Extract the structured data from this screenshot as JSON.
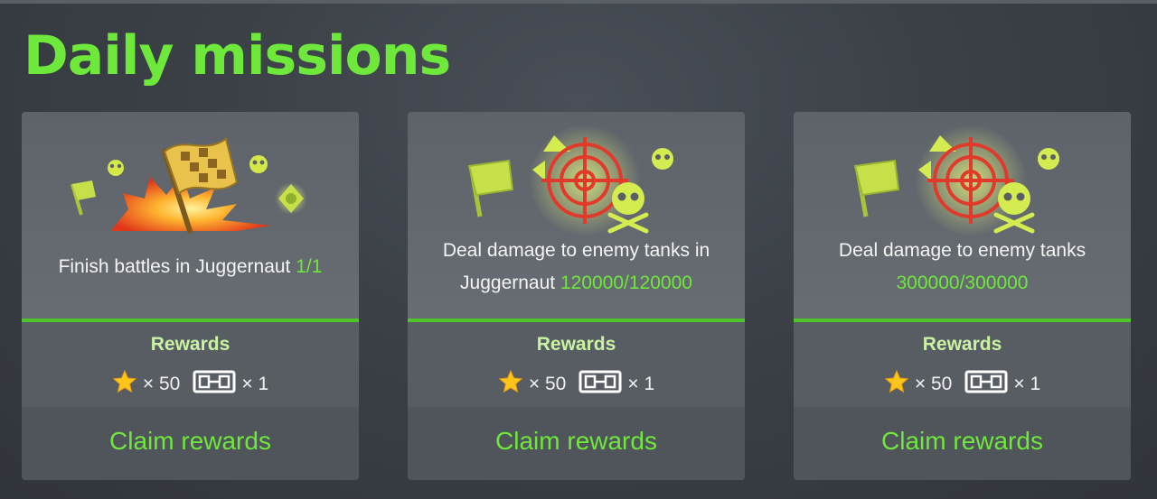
{
  "page": {
    "title": "Daily missions"
  },
  "colors": {
    "accent_green": "#6ee83a",
    "rewards_title": "#c9f3a3",
    "card_bg": "#686d74",
    "divider": "#4ec62a"
  },
  "missions": [
    {
      "illustration": "checkered-flag-explosion-icon",
      "description": "Finish battles in Juggernaut",
      "progress": "1/1",
      "rewards_title": "Rewards",
      "rewards": [
        {
          "icon": "star-icon",
          "count": "× 50"
        },
        {
          "icon": "ticket-icon",
          "count": "× 1"
        }
      ],
      "claim_label": "Claim rewards"
    },
    {
      "illustration": "crosshair-target-icon",
      "description": "Deal damage to enemy tanks in Juggernaut",
      "progress": "120000/120000",
      "rewards_title": "Rewards",
      "rewards": [
        {
          "icon": "star-icon",
          "count": "× 50"
        },
        {
          "icon": "ticket-icon",
          "count": "× 1"
        }
      ],
      "claim_label": "Claim rewards"
    },
    {
      "illustration": "crosshair-target-icon",
      "description": "Deal damage to enemy tanks",
      "progress": "300000/300000",
      "rewards_title": "Rewards",
      "rewards": [
        {
          "icon": "star-icon",
          "count": "× 50"
        },
        {
          "icon": "ticket-icon",
          "count": "× 1"
        }
      ],
      "claim_label": "Claim rewards"
    }
  ]
}
